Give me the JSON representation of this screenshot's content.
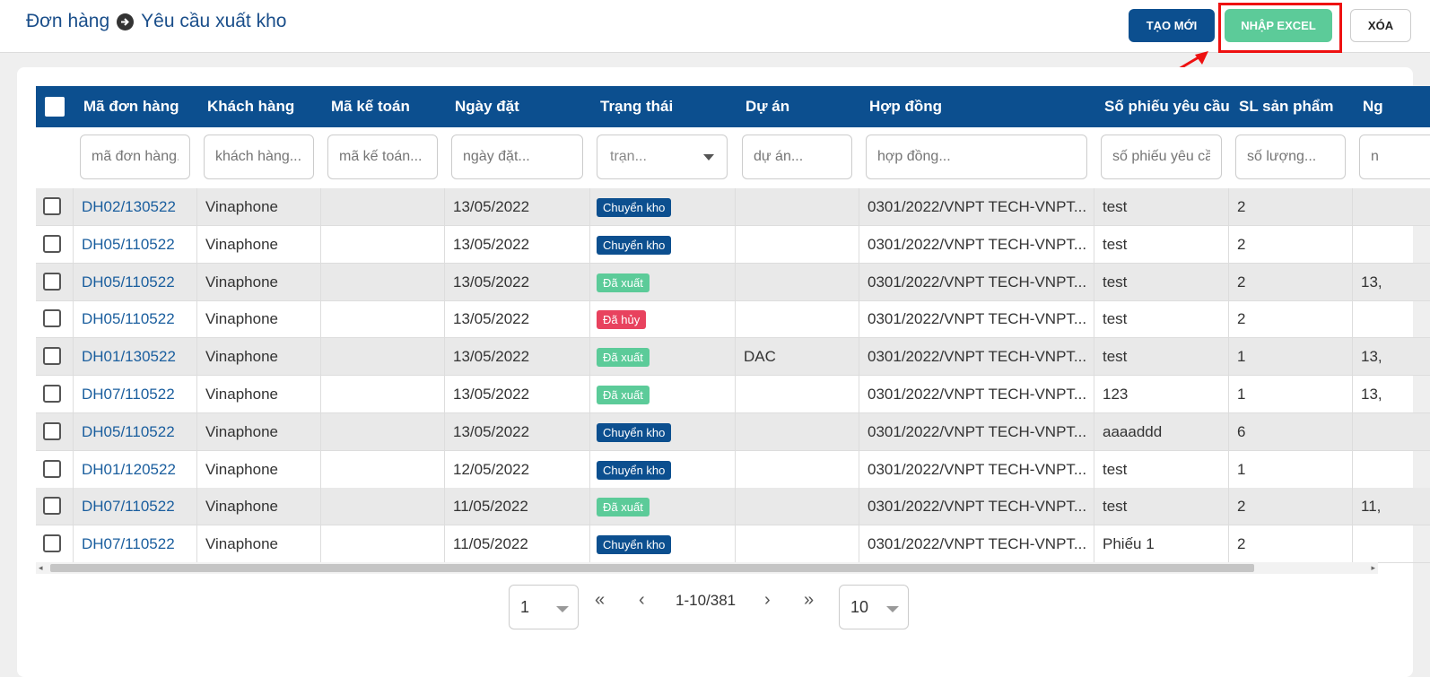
{
  "breadcrumb": {
    "parent": "Đơn hàng",
    "current": "Yêu cầu xuất kho"
  },
  "toolbar": {
    "new_label": "TẠO MỚI",
    "import_label": "NHẬP EXCEL",
    "delete_label": "XÓA"
  },
  "table": {
    "columns": [
      "Mã đơn hàng",
      "Khách hàng",
      "Mã kế toán",
      "Ngày đặt",
      "Trạng thái",
      "Dự án",
      "Hợp đồng",
      "Số phiếu yêu cầu",
      "SL sản phẩm",
      "Ng"
    ],
    "filters": {
      "order_code": "mã đơn hàng...",
      "customer": "khách hàng...",
      "accounting_code": "mã kế toán...",
      "order_date": "ngày đặt...",
      "status": "trạn...",
      "project": "dự án...",
      "contract": "hợp đồng...",
      "request_no": "số phiếu yêu cầu...",
      "quantity": "số lượng...",
      "extra": "n"
    },
    "rows": [
      {
        "code": "DH02/130522",
        "customer": "Vinaphone",
        "accounting": "",
        "date": "13/05/2022",
        "status": "Chuyển kho",
        "project": "",
        "contract": "0301/2022/VNPT TECH-VNPT...",
        "request": "test",
        "qty": "2",
        "extra": ""
      },
      {
        "code": "DH05/110522",
        "customer": "Vinaphone",
        "accounting": "",
        "date": "13/05/2022",
        "status": "Chuyển kho",
        "project": "",
        "contract": "0301/2022/VNPT TECH-VNPT...",
        "request": "test",
        "qty": "2",
        "extra": ""
      },
      {
        "code": "DH05/110522",
        "customer": "Vinaphone",
        "accounting": "",
        "date": "13/05/2022",
        "status": "Đã xuất",
        "project": "",
        "contract": "0301/2022/VNPT TECH-VNPT...",
        "request": "test",
        "qty": "2",
        "extra": "13,"
      },
      {
        "code": "DH05/110522",
        "customer": "Vinaphone",
        "accounting": "",
        "date": "13/05/2022",
        "status": "Đã hủy",
        "project": "",
        "contract": "0301/2022/VNPT TECH-VNPT...",
        "request": "test",
        "qty": "2",
        "extra": ""
      },
      {
        "code": "DH01/130522",
        "customer": "Vinaphone",
        "accounting": "",
        "date": "13/05/2022",
        "status": "Đã xuất",
        "project": "DAC",
        "contract": "0301/2022/VNPT TECH-VNPT...",
        "request": "test",
        "qty": "1",
        "extra": "13,"
      },
      {
        "code": "DH07/110522",
        "customer": "Vinaphone",
        "accounting": "",
        "date": "13/05/2022",
        "status": "Đã xuất",
        "project": "",
        "contract": "0301/2022/VNPT TECH-VNPT...",
        "request": "123",
        "qty": "1",
        "extra": "13,"
      },
      {
        "code": "DH05/110522",
        "customer": "Vinaphone",
        "accounting": "",
        "date": "13/05/2022",
        "status": "Chuyển kho",
        "project": "",
        "contract": "0301/2022/VNPT TECH-VNPT...",
        "request": "aaaaddd",
        "qty": "6",
        "extra": ""
      },
      {
        "code": "DH01/120522",
        "customer": "Vinaphone",
        "accounting": "",
        "date": "12/05/2022",
        "status": "Chuyển kho",
        "project": "",
        "contract": "0301/2022/VNPT TECH-VNPT...",
        "request": "test",
        "qty": "1",
        "extra": ""
      },
      {
        "code": "DH07/110522",
        "customer": "Vinaphone",
        "accounting": "",
        "date": "11/05/2022",
        "status": "Đã xuất",
        "project": "",
        "contract": "0301/2022/VNPT TECH-VNPT...",
        "request": "test",
        "qty": "2",
        "extra": "11,"
      },
      {
        "code": "DH07/110522",
        "customer": "Vinaphone",
        "accounting": "",
        "date": "11/05/2022",
        "status": "Chuyển kho",
        "project": "",
        "contract": "0301/2022/VNPT TECH-VNPT...",
        "request": "Phiếu 1",
        "qty": "2",
        "extra": ""
      }
    ]
  },
  "status_colors": {
    "Chuyển kho": "#0c4f8f",
    "Đã xuất": "#5ccb99",
    "Đã hủy": "#e8425e"
  },
  "pagination": {
    "page": "1",
    "range": "1-10/381",
    "page_size": "10"
  },
  "icons": [
    "arrow-right-circle-icon",
    "first-page-icon",
    "prev-page-icon",
    "next-page-icon",
    "last-page-icon",
    "chevron-down-icon"
  ]
}
